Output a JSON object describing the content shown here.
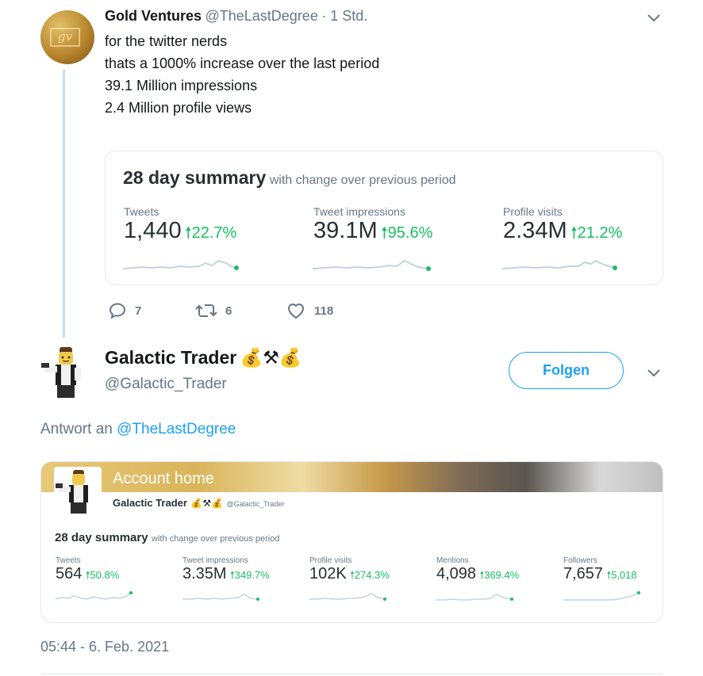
{
  "tweet1": {
    "name": "Gold Ventures",
    "handle": "@TheLastDegree",
    "time": "· 1 Std.",
    "avatar_text": "gv",
    "lines": [
      "for the twitter nerds",
      "thats a 1000% increase over the last period",
      "",
      "39.1 Million impressions",
      "2.4 Million profile views"
    ],
    "card": {
      "title": "28 day summary",
      "subtitle": "with change over previous period",
      "stats": [
        {
          "label": "Tweets",
          "value": "1,440",
          "change": "22.7%"
        },
        {
          "label": "Tweet impressions",
          "value": "39.1M",
          "change": "95.6%"
        },
        {
          "label": "Profile visits",
          "value": "2.34M",
          "change": "21.2%"
        }
      ]
    },
    "actions": {
      "replies": "7",
      "retweets": "6",
      "likes": "118"
    }
  },
  "tweet2": {
    "name": "Galactic Trader",
    "emoji": "💰⚒💰",
    "handle": "@Galactic_Trader",
    "follow_label": "Folgen",
    "reply_prefix": "Antwort an",
    "reply_to": "@TheLastDegree",
    "card": {
      "banner_title": "Account home",
      "account_name": "Galactic Trader",
      "account_emoji": "💰⚒💰",
      "account_handle": "@Galactic_Trader",
      "title": "28 day summary",
      "subtitle": "with change over previous period",
      "stats": [
        {
          "label": "Tweets",
          "value": "564",
          "change": "50.8%"
        },
        {
          "label": "Tweet impressions",
          "value": "3.35M",
          "change": "349.7%"
        },
        {
          "label": "Profile visits",
          "value": "102K",
          "change": "274.3%"
        },
        {
          "label": "Mentions",
          "value": "4,098",
          "change": "369.4%"
        },
        {
          "label": "Followers",
          "value": "7,657",
          "change": "5,018"
        }
      ]
    },
    "timestamp": "05:44 - 6. Feb. 2021"
  },
  "colors": {
    "accent": "#1da1f2",
    "positive": "#17bf63",
    "muted": "#657786"
  }
}
